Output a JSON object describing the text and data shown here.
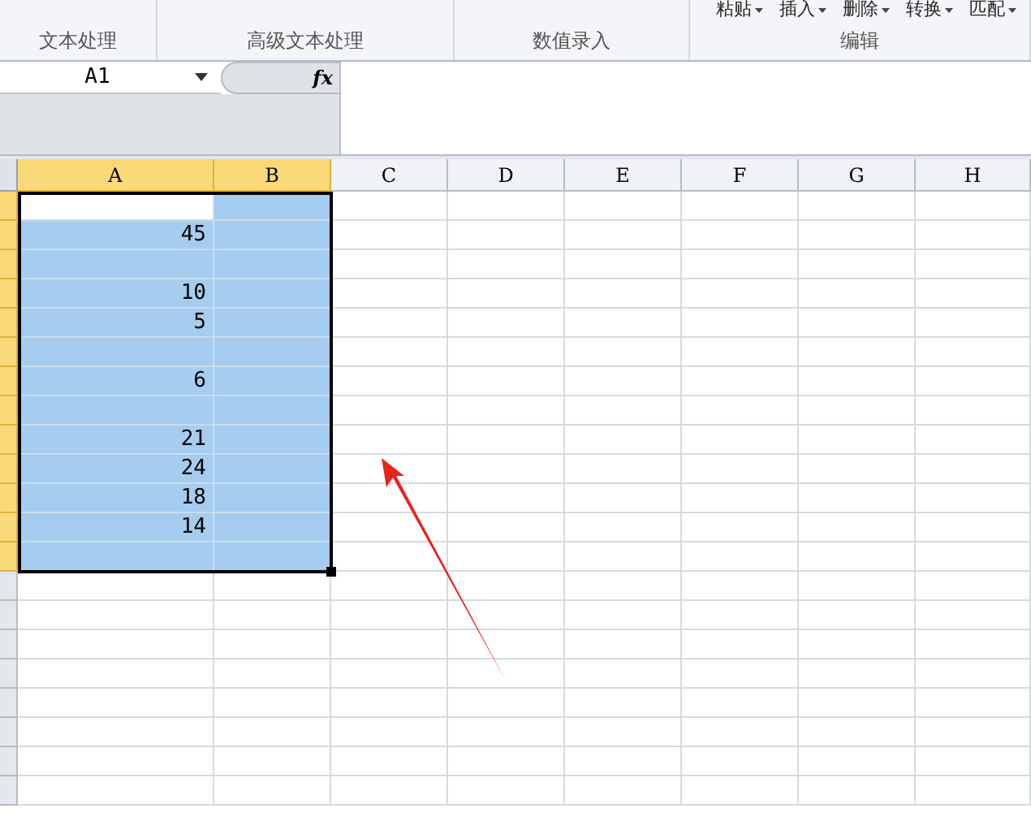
{
  "ribbon": {
    "groups": [
      {
        "label": "文本处理"
      },
      {
        "label": "高级文本处理"
      },
      {
        "label": "数值录入"
      },
      {
        "label": "编辑"
      }
    ],
    "edit_buttons": [
      {
        "label": "粘贴"
      },
      {
        "label": "插入"
      },
      {
        "label": "删除"
      },
      {
        "label": "转换"
      },
      {
        "label": "匹配"
      }
    ]
  },
  "formula_bar": {
    "name_box": "A1",
    "fx": "fx"
  },
  "sheet": {
    "columns": [
      {
        "label": "A",
        "selected": true
      },
      {
        "label": "B",
        "selected": true
      },
      {
        "label": "C",
        "selected": false
      },
      {
        "label": "D",
        "selected": false
      },
      {
        "label": "E",
        "selected": false
      },
      {
        "label": "F",
        "selected": false
      },
      {
        "label": "G",
        "selected": false
      },
      {
        "label": "H",
        "selected": false
      }
    ],
    "rows": [
      {
        "selected": true,
        "active": true
      },
      {
        "selected": true,
        "a": "45"
      },
      {
        "selected": true
      },
      {
        "selected": true,
        "a": "10"
      },
      {
        "selected": true,
        "a": "5"
      },
      {
        "selected": true
      },
      {
        "selected": true,
        "a": "6"
      },
      {
        "selected": true
      },
      {
        "selected": true,
        "a": "21"
      },
      {
        "selected": true,
        "a": "24"
      },
      {
        "selected": true,
        "a": "18"
      },
      {
        "selected": true,
        "a": "14"
      },
      {
        "selected": true
      },
      {
        "selected": false
      },
      {
        "selected": false
      },
      {
        "selected": false
      },
      {
        "selected": false
      },
      {
        "selected": false
      },
      {
        "selected": false
      },
      {
        "selected": false
      },
      {
        "selected": false
      }
    ]
  }
}
